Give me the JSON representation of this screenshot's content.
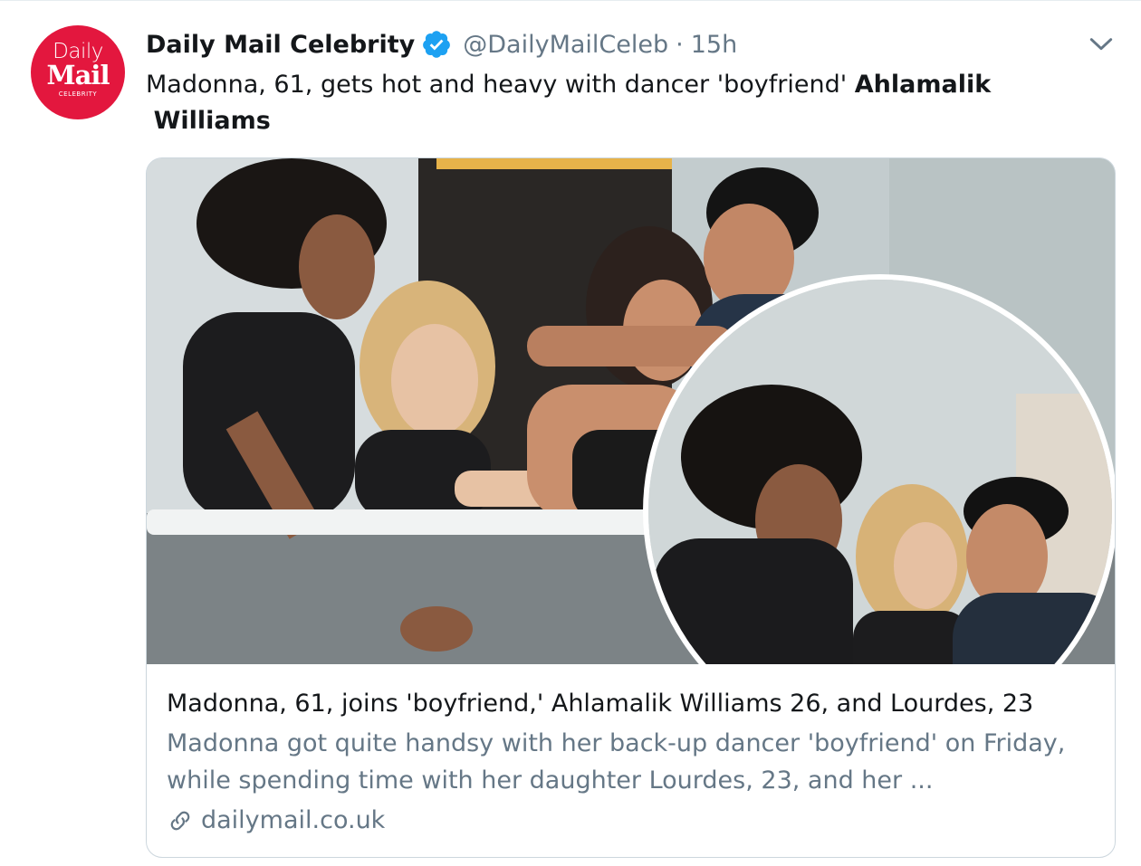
{
  "tweet": {
    "avatar": {
      "line1": "Daily",
      "line2": "Mail",
      "line3": "CELEBRITY",
      "color": "#e3173e"
    },
    "author_name": "Daily Mail Celebrity",
    "verified_icon": "verified-badge-icon",
    "handle": "@DailyMailCeleb",
    "separator": "·",
    "time": "15h",
    "menu_icon": "chevron-down-icon",
    "text_plain": "Madonna, 61, gets hot and heavy with dancer 'boyfriend' ",
    "text_bold_1": "Ahlamalik",
    "text_bold_2": "Williams"
  },
  "card": {
    "title": "Madonna, 61, joins 'boyfriend,' Ahlamalik Williams 26, and Lourdes, 23",
    "description": "Madonna got quite handsy with her back-up dancer 'boyfriend' on Friday, while spending time with her daughter Lourdes, 23, and her ...",
    "domain": "dailymail.co.uk",
    "link_icon": "link-icon"
  },
  "colors": {
    "verified": "#1da1f2",
    "secondary_text": "#657786",
    "border": "#ccd6dd"
  }
}
